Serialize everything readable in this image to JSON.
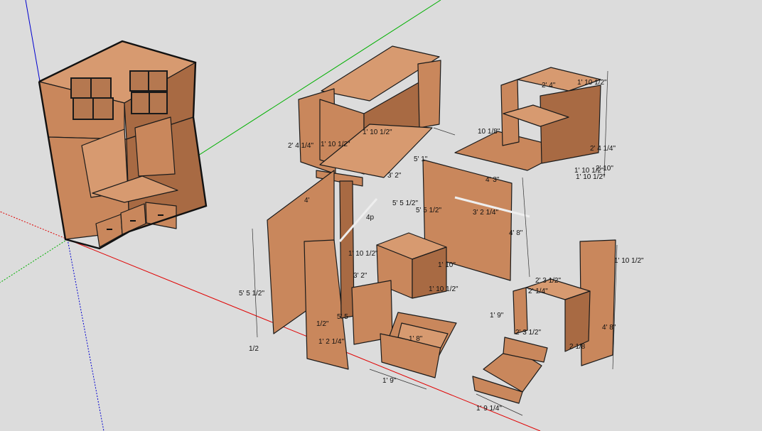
{
  "scene": {
    "axes": {
      "x_color": "#e00000",
      "y_color": "#00b000",
      "z_color": "#0000d0"
    },
    "colors": {
      "background": "#dcdcdc",
      "wood": "#c9875c",
      "wood_light": "#d79a70",
      "wood_dark": "#a86a43",
      "outline": "#1a1a1a"
    },
    "dims": {
      "d1": "2' 4\"",
      "d2": "1' 10 1/2\"",
      "d3": "1' 10 1/2\"",
      "d4": "10 1/8\"",
      "d5": "2' 4 1/4\"",
      "d6": "1' 10 1/2\"",
      "d7": "2' 10\"",
      "d8": "1' 10 1/2\"",
      "d9": "2' 4 1/4\"",
      "d10": "1' 10 1/2\"",
      "d11": "5' 1\"",
      "d12": "3' 2\"",
      "d13": "4'",
      "d14": "5' 5 1/2\"",
      "d15": "5' 5 1/2\"",
      "d16": "4' 3\"",
      "d17": "3' 2 1/4\"",
      "d18": "4' 8\"",
      "d19": "5' 5 1/2\"",
      "d20": "1/2\"",
      "d21": "1/2",
      "d22": "5' 5",
      "d23": "1' 2 1/4\"",
      "d24": "1' 10 1/2\"",
      "d25": "1' 10\"",
      "d26": "1' 10 1/2\"",
      "d27": "3' 2\"",
      "d28": "1' 8\"",
      "d29": "1' 9\"",
      "d30": "2' 3 1/2\"",
      "d31": "2' 1/4\"",
      "d32": "1' 9\"",
      "d33": "2' 3 1/2\"",
      "d34": "4' 8\"",
      "d35": "1' 10 1/2\"",
      "d36": "1' 9 1/4\"",
      "d37": "2 1/8",
      "d38": "4p"
    }
  }
}
